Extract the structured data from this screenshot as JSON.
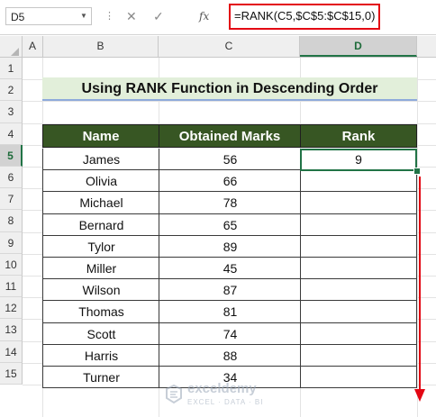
{
  "formula_bar": {
    "name_box": "D5",
    "formula": "=RANK(C5,$C$5:$C$15,0)",
    "fx_label": "fx",
    "cancel_glyph": "✕",
    "enter_glyph": "✓"
  },
  "columns": [
    "A",
    "B",
    "C",
    "D"
  ],
  "rows": [
    "1",
    "2",
    "3",
    "4",
    "5",
    "6",
    "7",
    "8",
    "9",
    "10",
    "11",
    "12",
    "13",
    "14",
    "15"
  ],
  "sheet": {
    "title": "Using RANK Function in Descending Order",
    "headers": [
      "Name",
      "Obtained Marks",
      "Rank"
    ],
    "records": [
      {
        "name": "James",
        "marks": "56",
        "rank": "9"
      },
      {
        "name": "Olivia",
        "marks": "66",
        "rank": ""
      },
      {
        "name": "Michael",
        "marks": "78",
        "rank": ""
      },
      {
        "name": "Bernard",
        "marks": "65",
        "rank": ""
      },
      {
        "name": "Tylor",
        "marks": "89",
        "rank": ""
      },
      {
        "name": "Miller",
        "marks": "45",
        "rank": ""
      },
      {
        "name": "Wilson",
        "marks": "87",
        "rank": ""
      },
      {
        "name": "Thomas",
        "marks": "81",
        "rank": ""
      },
      {
        "name": "Scott",
        "marks": "74",
        "rank": ""
      },
      {
        "name": "Harris",
        "marks": "88",
        "rank": ""
      },
      {
        "name": "Turner",
        "marks": "34",
        "rank": ""
      }
    ]
  },
  "watermark": {
    "brand": "exceldemy",
    "tagline": "EXCEL · DATA · BI"
  },
  "colors": {
    "header_fill": "#375623",
    "title_fill": "#e2efda",
    "formula_outline": "#e30613",
    "arrow": "#e30613",
    "selection": "#217346"
  }
}
